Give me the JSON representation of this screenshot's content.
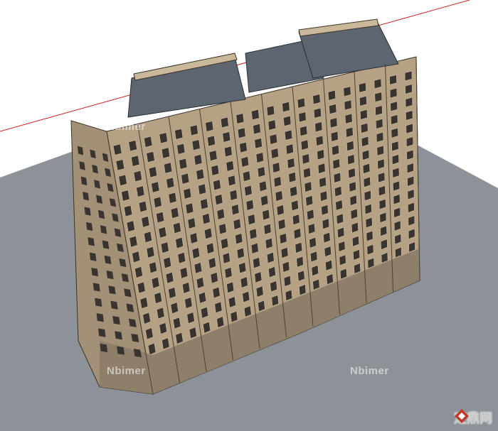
{
  "watermarks": {
    "top": "Nbimer",
    "left_bottom": "Nbimer",
    "right_bottom": "Nbimer"
  },
  "brand": {
    "text": "定鼎网",
    "logo_icon": "diamond-logo-icon",
    "color": "#c0392b"
  },
  "colors": {
    "ground": "#8c9298",
    "facade": "#b5a284",
    "facade_side": "#a39177",
    "roof": "#5d6670",
    "axis": "#d01c1c"
  }
}
